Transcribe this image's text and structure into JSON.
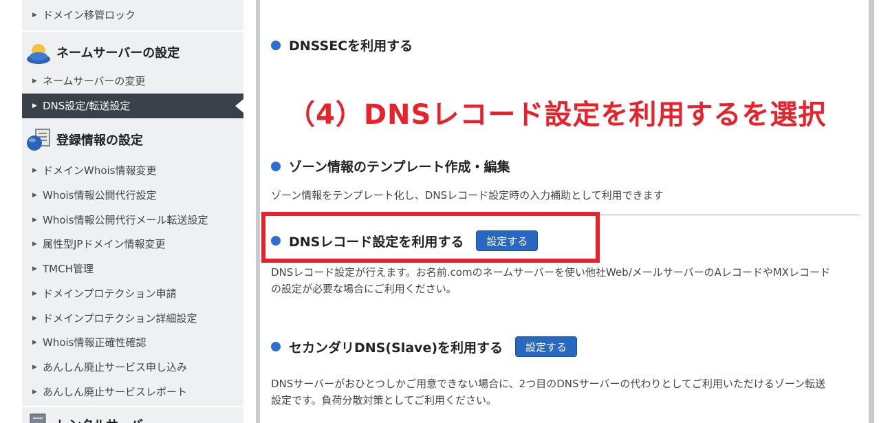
{
  "sidebar": {
    "top_item": "ドメイン移管ロック",
    "nameserver_section": {
      "title": "ネームサーバーの設定",
      "items": [
        "ネームサーバーの変更",
        "DNS設定/転送設定"
      ]
    },
    "registration_section": {
      "title": "登録情報の設定",
      "items": [
        "ドメインWhois情報変更",
        "Whois情報公開代行設定",
        "Whois情報公開代行メール転送設定",
        "属性型JPドメイン情報変更",
        "TMCH管理",
        "ドメインプロテクション申請",
        "ドメインプロテクション詳細設定",
        "Whois情報正確性確認",
        "あんしん廃止サービス申し込み",
        "あんしん廃止サービスレポート"
      ]
    },
    "next_section_title": "レンタルサーバー"
  },
  "main": {
    "dnssec_title": "DNSSECを利用する",
    "annotation": "（4）DNSレコード設定を利用するを選択",
    "zone_template_title": "ゾーン情報のテンプレート作成・編集",
    "zone_template_desc": "ゾーン情報をテンプレート化し、DNSレコード設定時の入力補助として利用できます",
    "dns_record_title": "DNSレコード設定を利用する",
    "dns_record_button": "設定する",
    "dns_record_desc_1": "DNSレコード設定が行えます。お名前.comのネームサーバーを使い他社Web/メールサーバーのAレコードやMXレコード",
    "dns_record_desc_2": "の設定が必要な場合にご利用ください。",
    "secondary_dns_title": "セカンダリDNS(Slave)を利用する",
    "secondary_dns_button": "設定する",
    "secondary_dns_desc_1": "DNSサーバーがおひとつしかご用意できない場合に、2つ目のDNSサーバーの代わりとしてご利用いただけるゾーン転送",
    "secondary_dns_desc_2": "設定です。負荷分散対策としてご利用ください。"
  },
  "colors": {
    "accent_blue": "#2c6fd1",
    "button_blue": "#2868c3",
    "annotation_red": "#e8222a",
    "sidebar_active": "#3a4149"
  }
}
